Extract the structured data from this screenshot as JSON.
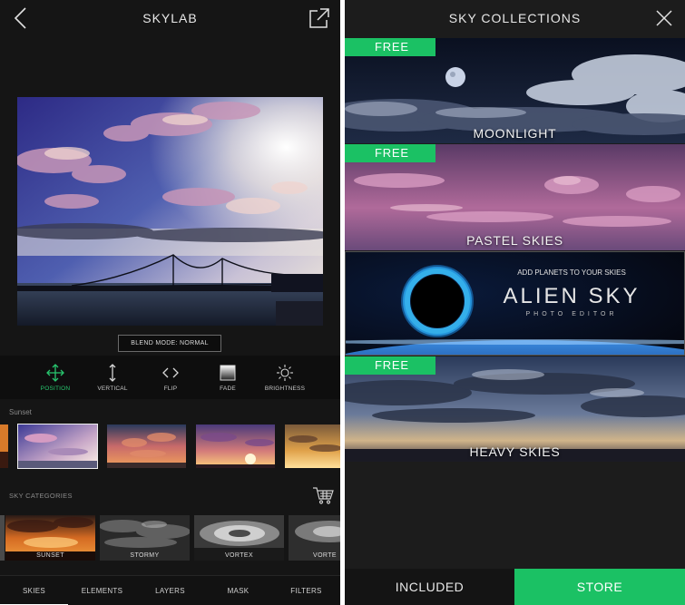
{
  "left": {
    "title": "SKYLAB",
    "blend_mode": "BLEND MODE: NORMAL",
    "tools": [
      {
        "label": "POSITION",
        "icon": "move-arrows-icon",
        "active": true
      },
      {
        "label": "VERTICAL",
        "icon": "vertical-arrow-icon",
        "active": false
      },
      {
        "label": "FLIP",
        "icon": "flip-chevrons-icon",
        "active": false
      },
      {
        "label": "FADE",
        "icon": "fade-square-icon",
        "active": false
      },
      {
        "label": "BRIGHTNESS",
        "icon": "sun-icon",
        "active": false
      }
    ],
    "sunset_label": "Sunset",
    "sky_categories_label": "SKY CATEGORIES",
    "categories": [
      "SUNSET",
      "STORMY",
      "VORTEX",
      "VORTE"
    ],
    "tabs": [
      "SKIES",
      "ELEMENTS",
      "LAYERS",
      "MASK",
      "FILTERS"
    ],
    "active_tab": "SKIES"
  },
  "right": {
    "title": "SKY COLLECTIONS",
    "collections": [
      {
        "badge": "FREE",
        "name": "MOONLIGHT"
      },
      {
        "badge": "FREE",
        "name": "PASTEL SKIES"
      },
      {
        "tagline": "ADD PLANETS TO YOUR SKIES",
        "name": "ALIEN SKY",
        "sub": "PHOTO EDITOR"
      },
      {
        "badge": "FREE",
        "name": "HEAVY SKIES"
      }
    ],
    "buttons": {
      "included": "INCLUDED",
      "store": "STORE"
    }
  },
  "colors": {
    "accent_green": "#1bc164",
    "background": "#151515"
  }
}
